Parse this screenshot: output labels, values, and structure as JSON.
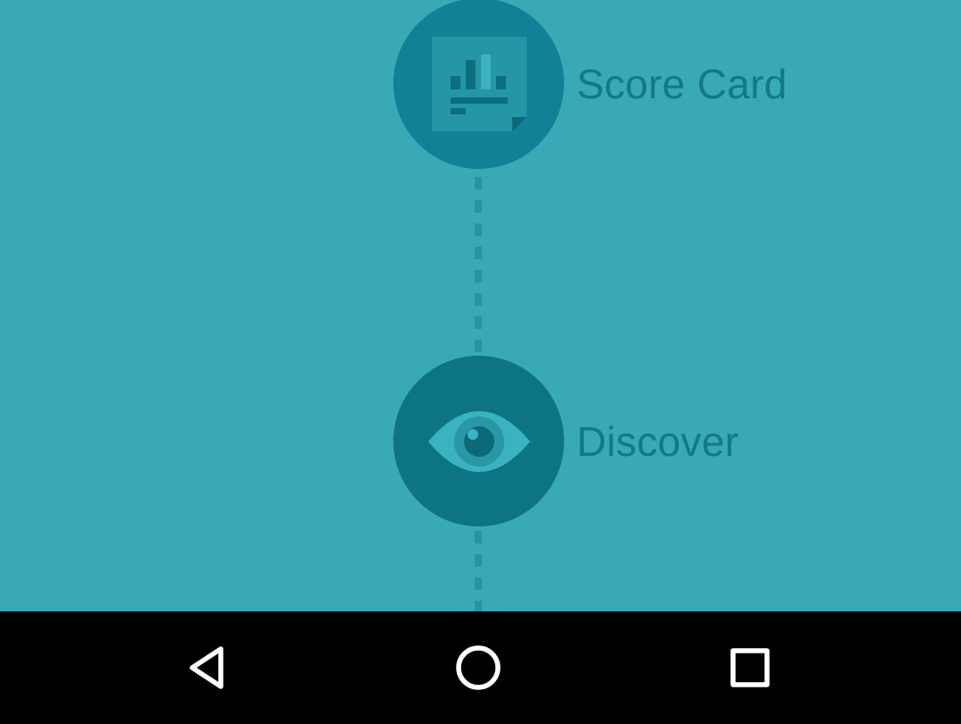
{
  "steps": [
    {
      "label": "Score Card",
      "icon": "scorecard-icon"
    },
    {
      "label": "Discover",
      "icon": "eye-icon"
    }
  ],
  "navbar": {
    "back_icon": "back-triangle-icon",
    "home_icon": "home-circle-icon",
    "recents_icon": "recents-square-icon"
  },
  "colors": {
    "background": "#3aa9b6",
    "scorecard_circle": "#0f8297",
    "discover_circle": "#0d7483",
    "label_text": "#137989",
    "connector": "#2a93a3",
    "navbar": "#000000",
    "nav_icon": "#ffffff"
  }
}
